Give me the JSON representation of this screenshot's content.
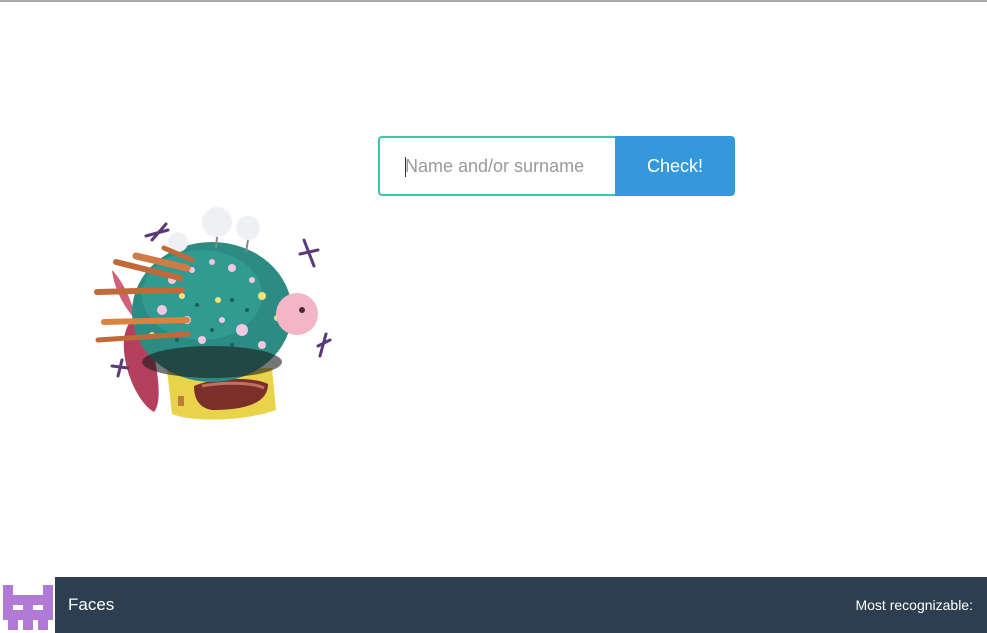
{
  "search": {
    "placeholder": "Name and/or surname",
    "button_label": "Check!"
  },
  "mascot": {
    "icon": "pufferfish-airship-illustration"
  },
  "footer": {
    "logo_icon": "pixel-face-logo",
    "title": "Faces",
    "most_recognizable_label": "Most recognizable:"
  },
  "colors": {
    "input_border": "#3bc8a8",
    "button": "#3498db",
    "footer_bg": "#2c3e50",
    "logo": "#b07ad6"
  }
}
